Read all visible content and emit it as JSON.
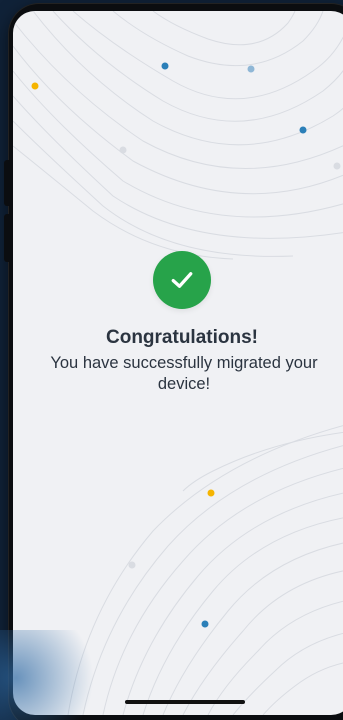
{
  "success": {
    "title": "Congratulations!",
    "message": "You have successfully migrated your device!"
  },
  "colors": {
    "check_bg": "#27a34a",
    "dot_yellow": "#f5b400",
    "dot_blue": "#2b7fb8",
    "dot_lightblue": "#8fb7d6",
    "text": "#2b3440"
  },
  "icons": {
    "success": "checkmark-icon"
  }
}
